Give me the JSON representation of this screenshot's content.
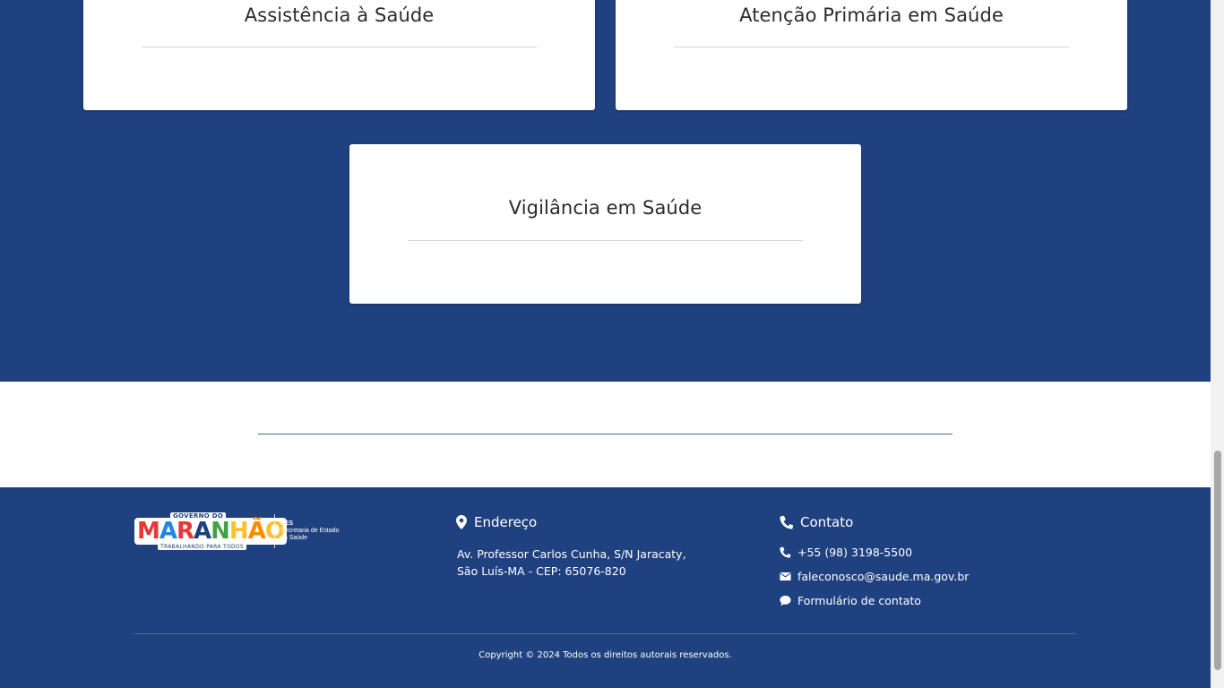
{
  "cards": [
    {
      "title": "Assistência à Saúde"
    },
    {
      "title": "Atenção Primária em Saúde"
    },
    {
      "title": "Vigilância em Saúde"
    }
  ],
  "logo": {
    "top_text": "GOVERNO DO",
    "word": "MARANHÃO",
    "tagline": "TRABALHANDO PARA TODOS",
    "ses_abbr": "SES",
    "ses_line1": "Secretaria de Estado",
    "ses_line2": "da Saúde"
  },
  "address": {
    "title": "Endereço",
    "line1": "Av. Professor Carlos Cunha, S/N Jaracaty,",
    "line2": "São Luís-MA - CEP: 65076-820"
  },
  "contact": {
    "title": "Contato",
    "phone": "+55 (98) 3198-5500",
    "email": "faleconosco@saude.ma.gov.br",
    "form": "Formulário de contato"
  },
  "footer": {
    "copyright": "Copyright © 2024 Todos os direitos autorais reservados."
  },
  "colors": {
    "primary_blue": "#204180",
    "card_bg": "#ffffff",
    "divider": "#3d6f8f"
  },
  "icons": {
    "address": "map-marker-icon",
    "contact": "phone-icon",
    "email": "envelope-icon",
    "form": "chat-bubble-icon"
  }
}
